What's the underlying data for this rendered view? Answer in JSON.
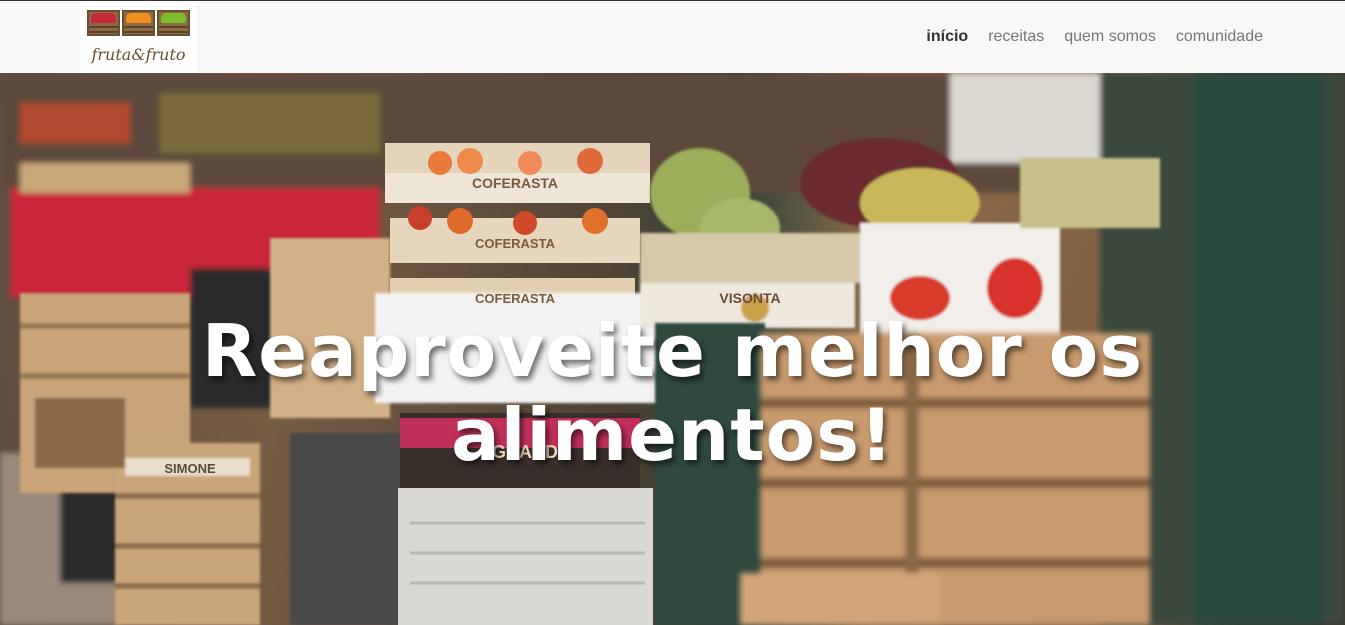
{
  "logo": {
    "text": "fruta&fruto"
  },
  "nav": {
    "items": [
      {
        "label": "início",
        "active": true
      },
      {
        "label": "receitas",
        "active": false
      },
      {
        "label": "quem somos",
        "active": false
      },
      {
        "label": "comunidade",
        "active": false
      }
    ]
  },
  "hero": {
    "title": "Reaproveite melhor os alimentos!",
    "crate_labels": [
      "COFERASTA",
      "COFERASTA",
      "COFERASTA",
      "GRAND",
      "SIMONE",
      "VISONTA"
    ]
  },
  "colors": {
    "nav_bg": "#f8f8f8",
    "nav_text": "#777777",
    "nav_active": "#333333",
    "hero_text": "#ffffff"
  }
}
